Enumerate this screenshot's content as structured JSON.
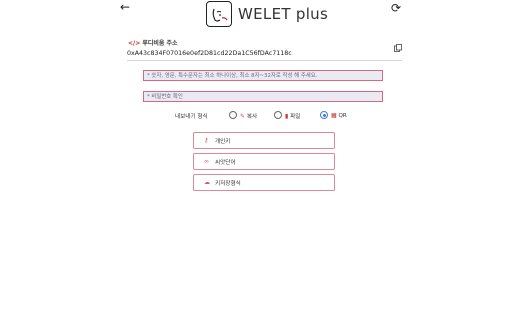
{
  "header": {
    "back_glyph": "←",
    "logo_text": "WELET plus",
    "refresh_glyph": "⟳"
  },
  "wallet": {
    "label_code": "</>",
    "label": "루디비움 주소",
    "address": "0xA43c834F07016e0ef2D81cd22Da1C56fDAc7118c"
  },
  "form": {
    "password_placeholder": "* 숫자, 영문, 특수문자는 최소 하나이상, 최소 8자~32자로 작성 해 주세요.",
    "confirm_placeholder": "* 비밀번호 확인"
  },
  "export": {
    "label": "내보내기 형식",
    "options": [
      {
        "label": "복사",
        "icon": "pencil-icon",
        "glyph": "✎",
        "color": "#d04a5a",
        "selected": false
      },
      {
        "label": "파일",
        "icon": "file-icon",
        "glyph": "▮",
        "color": "#c9302c",
        "selected": false
      },
      {
        "label": "QR",
        "icon": "qr-icon",
        "glyph": "▦",
        "color": "#c9302c",
        "selected": true
      }
    ]
  },
  "actions": [
    {
      "label": "개인키",
      "icon": "key-icon",
      "glyph": "⚷"
    },
    {
      "label": "씨앗단어",
      "icon": "seed-icon",
      "glyph": "∞"
    },
    {
      "label": "키저장형식",
      "icon": "keystore-icon",
      "glyph": "☁"
    }
  ],
  "colors": {
    "accent": "#d46a7e",
    "brand_red": "#c9302c",
    "radio_selected": "#3b7ddd",
    "field_bg": "#e9eaf2"
  }
}
